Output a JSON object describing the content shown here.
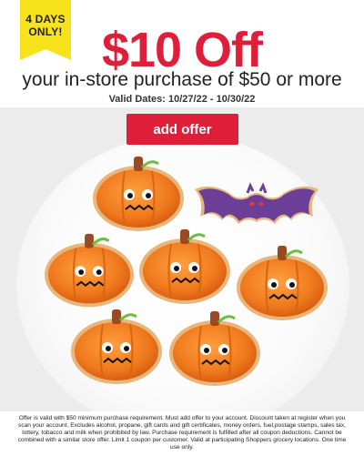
{
  "ribbon": {
    "line1": "4 DAYS",
    "line2": "ONLY!"
  },
  "offer": {
    "headline": "$10 Off",
    "subhead": "your in-store purchase of $50 or more",
    "valid_dates": "Valid Dates: 10/27/22 - 10/30/22",
    "button_label": "add offer"
  },
  "colors": {
    "brand_red": "#df1f3a",
    "ribbon_yellow": "#f7e21b",
    "pumpkin_orange": "#f07a1e",
    "bat_purple": "#6b3f97"
  },
  "image": {
    "icons": [
      "pumpkin-cookie-icon",
      "bat-cookie-icon"
    ]
  },
  "footer": {
    "disclaimer": "Offer is valid with $50 minimum purchase requirement. Must add offer to your account. Discount taken at register when you scan your account. Excludes alcohol, propane, gift cards and gift certificates, money orders, fuel,postage stamps, sales tax, lottery, tobacco and milk when prohibited by law. Purchase requirement is fulfilled after all coupon deductions. Cannot be combined with a similar store offer. Limit 1 coupon per customer. Valid at participating Shoppers grocery locations. One time use only."
  }
}
